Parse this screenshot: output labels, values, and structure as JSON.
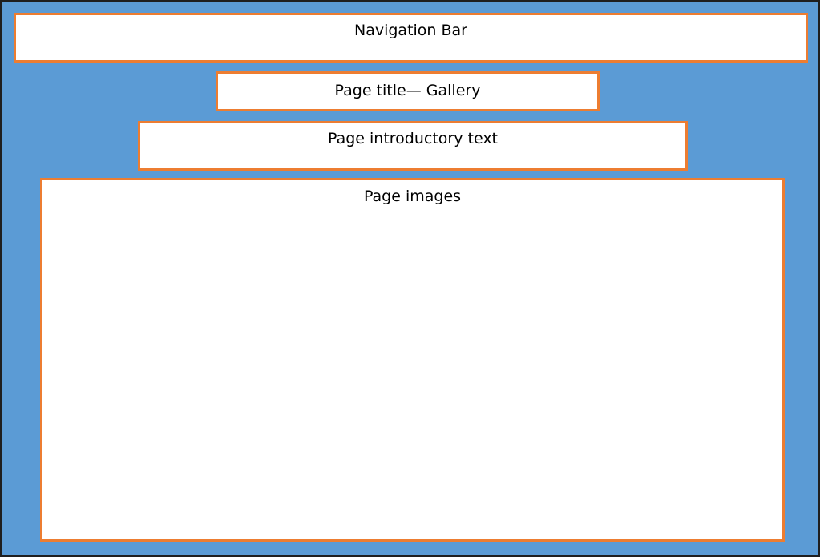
{
  "colors": {
    "background": "#5b9bd5",
    "box_fill": "#ffffff",
    "box_border": "#ed7d31",
    "frame_border": "#1f1f1f"
  },
  "boxes": {
    "navigation_bar": "Navigation Bar",
    "page_title": "Page title— Gallery",
    "intro_text": "Page introductory text",
    "images": "Page images"
  }
}
